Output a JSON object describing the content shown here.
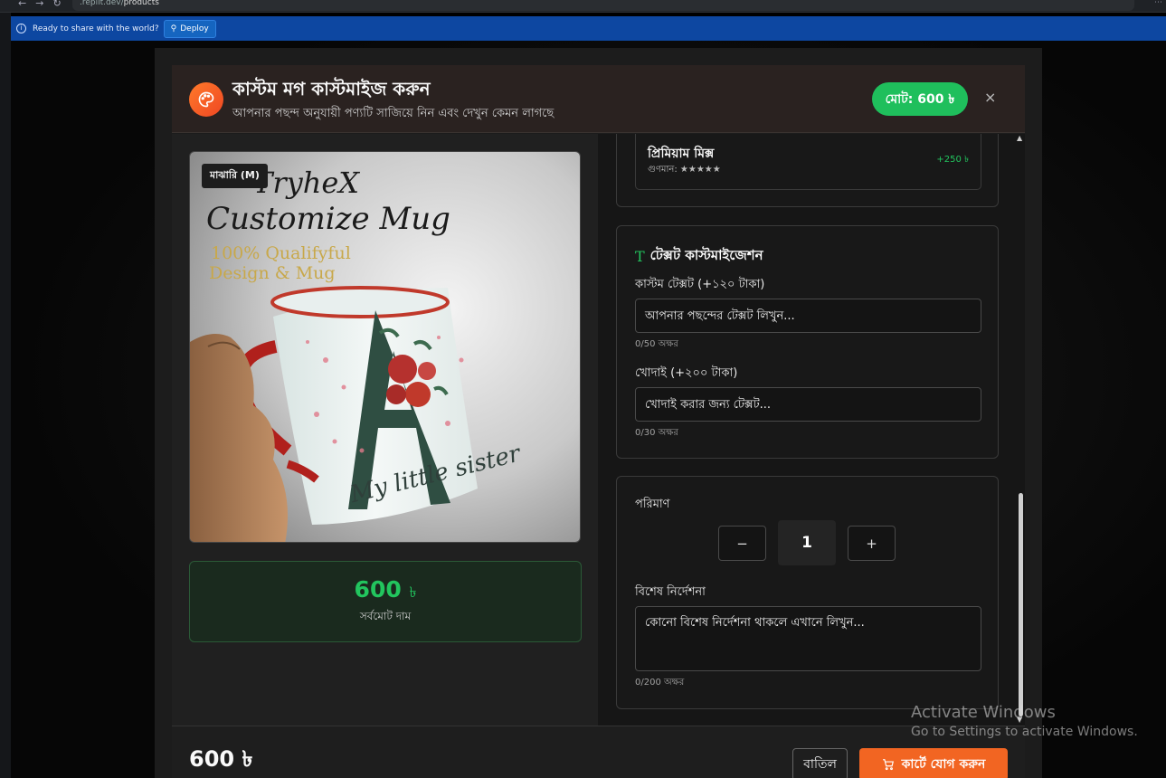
{
  "browser": {
    "url_prefix": ".replit.dev/",
    "url_path": "products"
  },
  "deploy_bar": {
    "message": "Ready to share with the world?",
    "button_label": "Deploy"
  },
  "header": {
    "title": "কাস্টম মগ কাস্টমাইজ করুন",
    "subtitle": "আপনার পছন্দ অনুযায়ী পণ্যটি সাজিয়ে নিন এবং দেখুন কেমন লাগছে",
    "total_label": "মোট: 600 ৳",
    "close_label": "×"
  },
  "preview": {
    "size_badge": "মাঝারি (M)",
    "image_lines": [
      "TryheX",
      "Customize Mug",
      "100% Qualifyful",
      "Design & Mug",
      "My little sister"
    ],
    "price": "600",
    "currency": "৳",
    "price_label": "সর্বমোট দাম"
  },
  "option": {
    "name": "প্রিমিয়াম মিক্স",
    "quality_label": "গুণমান:",
    "stars": "★★★★★",
    "price": "+250 ৳"
  },
  "text_section": {
    "title": "টেক্সট কাস্টমাইজেশন",
    "custom_text_label": "কাস্টম টেক্সট (+১২০ টাকা)",
    "custom_text_placeholder": "আপনার পছন্দের টেক্সট লিখুন...",
    "custom_text_count": "0/50 অক্ষর",
    "engrave_label": "খোদাই (+২০০ টাকা)",
    "engrave_placeholder": "খোদাই করার জন্য টেক্সট...",
    "engrave_count": "0/30 অক্ষর"
  },
  "quantity_section": {
    "label": "পরিমাণ",
    "decrement": "−",
    "value": "1",
    "increment": "+",
    "notes_label": "বিশেষ নির্দেশনা",
    "notes_placeholder": "কোনো বিশেষ নির্দেশনা থাকলে এখানে লিখুন...",
    "notes_count": "0/200 অক্ষর"
  },
  "footer": {
    "total": "600 ৳",
    "cancel_label": "বাতিল",
    "add_to_cart_label": "কার্টে যোগ করুন"
  },
  "watermark": {
    "line1": "Activate Windows",
    "line2": "Go to Settings to activate Windows."
  },
  "colors": {
    "accent_green": "#22c55e",
    "accent_orange": "#f26522",
    "deploy_blue": "#0d47a1"
  }
}
